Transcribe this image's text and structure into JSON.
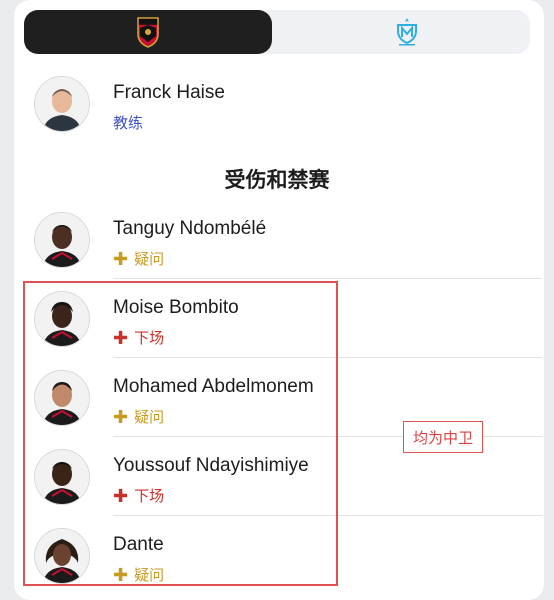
{
  "tabs": [
    {
      "team": "OGC Nice",
      "icon": "nice-crest-icon",
      "active": true
    },
    {
      "team": "Olympique de Marseille",
      "icon": "om-crest-icon",
      "active": false
    }
  ],
  "coach": {
    "name": "Franck Haise",
    "role": "教练"
  },
  "section_title": "受伤和禁赛",
  "players": [
    {
      "name": "Tanguy Ndombélé",
      "status": "疑问",
      "status_type": "doubt"
    },
    {
      "name": "Moise Bombito",
      "status": "下场",
      "status_type": "out"
    },
    {
      "name": "Mohamed Abdelmonem",
      "status": "疑问",
      "status_type": "doubt"
    },
    {
      "name": "Youssouf Ndayishimiye",
      "status": "下场",
      "status_type": "out"
    },
    {
      "name": "Dante",
      "status": "疑问",
      "status_type": "doubt"
    }
  ],
  "annotation": "均为中卫",
  "colors": {
    "doubt": "#c99a20",
    "out": "#c8312a",
    "role": "#3f51c6",
    "highlight": "#e05252"
  }
}
